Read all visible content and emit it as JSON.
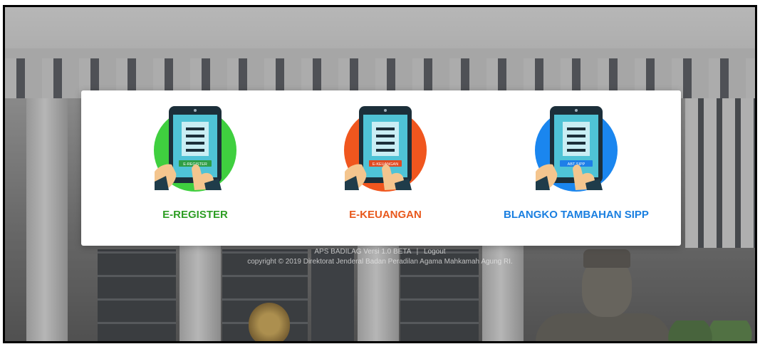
{
  "menu": {
    "items": [
      {
        "label": "E-REGISTER",
        "screen_text": "E-REGISTER",
        "icon": "tablet-hand-icon",
        "circle_color": "#3fcf3f",
        "label_color": "#2e9e24",
        "button_color": "#2f9e45"
      },
      {
        "label": "E-KEUANGAN",
        "screen_text": "E-KEUANGAN",
        "icon": "tablet-hand-icon",
        "circle_color": "#f0561e",
        "label_color": "#e8581c",
        "button_color": "#e04a22"
      },
      {
        "label": "BLANGKO TAMBAHAN SIPP",
        "screen_text": "ABT SIPP",
        "icon": "tablet-hand-icon",
        "circle_color": "#1a86ef",
        "label_color": "#1a7fe0",
        "button_color": "#1e7fe8"
      }
    ]
  },
  "footer": {
    "app_name": "APS BADILAG Versi 1.0 BETA",
    "separator": "|",
    "logout_label": "Logout",
    "copyright": "copyright © 2019 Direktorat Jenderal Badan Peradilan Agama Mahkamah Agung RI."
  }
}
